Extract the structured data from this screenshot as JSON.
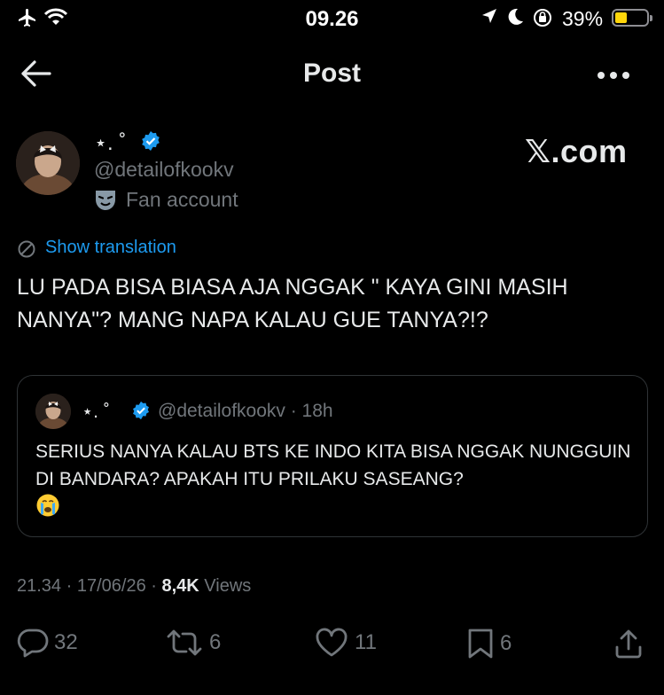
{
  "status_bar": {
    "time": "09.26",
    "battery": "39%",
    "battery_level": 0.39,
    "icons": [
      "airplane-icon",
      "wifi-icon",
      "location-icon",
      "moon-icon",
      "orientation-lock-icon",
      "battery-icon"
    ]
  },
  "header": {
    "title": "Post",
    "back_icon": "back-arrow-icon",
    "more_icon": "more-icon"
  },
  "author": {
    "display_name": "⋆. ˚",
    "handle": "@detailofkookv",
    "badge": "Fan account",
    "verified_color": "#1d9bf0"
  },
  "watermark": "𝕏.com",
  "translation_label": "Show translation",
  "post_text": "LU PADA BISA BIASA AJA NGGAK \" KAYA GINI MASIH NANYA\"? MANG NAPA KALAU GUE TANYA?!?",
  "quote": {
    "display_name": "⋆. ˚",
    "handle_time": "@detailofkookv · 18h",
    "text": "SERIUS NANYA KALAU BTS KE INDO KITA BISA NGGAK NUNGGUIN DI BANDARA? APAKAH ITU PRILAKU SASEANG?",
    "emoji": "😭"
  },
  "meta": {
    "time": "21.34",
    "date": "17/06/26",
    "views_count": "8,4K",
    "views_label": "Views"
  },
  "actions": {
    "replies": "32",
    "reposts": "6",
    "likes": "11",
    "bookmarks": "6"
  },
  "colors": {
    "accent": "#1d9bf0",
    "background": "#000000",
    "secondary_text": "#71767b"
  }
}
